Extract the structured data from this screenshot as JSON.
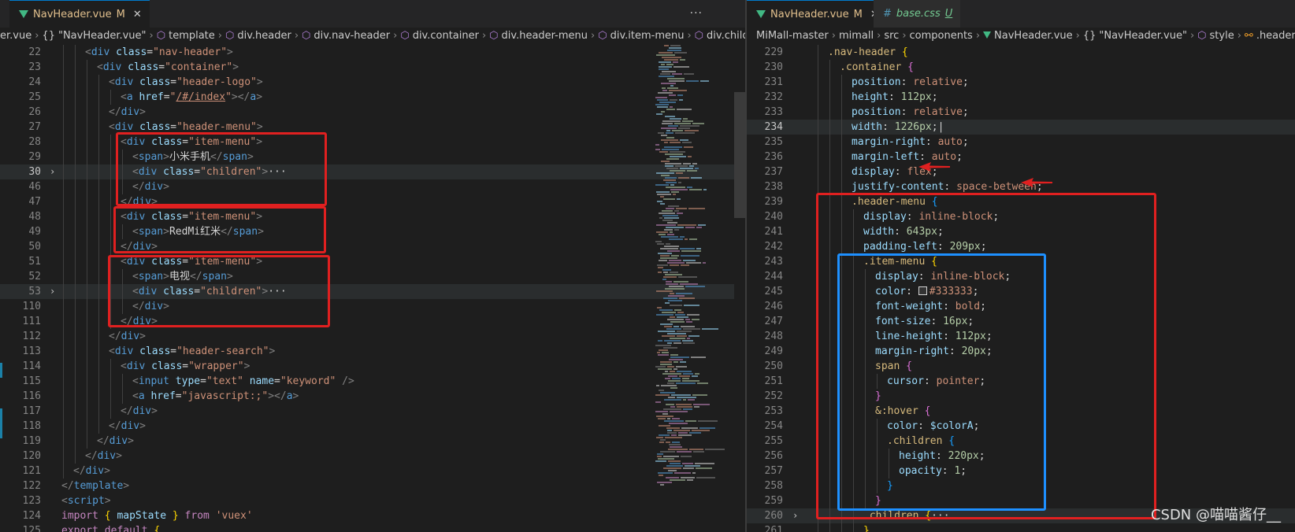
{
  "left": {
    "tabs": [
      {
        "name": "NavHeader.vue",
        "status": "M"
      }
    ],
    "more_label": "···",
    "breadcrumb": [
      "er.vue",
      "\"NavHeader.vue\"",
      "template",
      "div.header",
      "div.nav-header",
      "div.container",
      "div.header-menu",
      "div.item-menu",
      "div.children"
    ],
    "line_numbers": [
      "22",
      "23",
      "24",
      "25",
      "26",
      "27",
      "28",
      "29",
      "30",
      "46",
      "47",
      "48",
      "49",
      "50",
      "51",
      "52",
      "53",
      "110",
      "111",
      "112",
      "113",
      "114",
      "115",
      "116",
      "117",
      "118",
      "119",
      "120",
      "121",
      "122",
      "123",
      "124",
      "125"
    ]
  },
  "right": {
    "tabs": [
      {
        "name": "NavHeader.vue",
        "status": "M",
        "close": "✕"
      },
      {
        "name": "base.css",
        "status": "U"
      }
    ],
    "breadcrumb": [
      "MiMall-master",
      "mimall",
      "src",
      "components",
      "NavHeader.vue",
      "\"NavHeader.vue\"",
      "style",
      ".header"
    ],
    "line_numbers": [
      "229",
      "230",
      "231",
      "232",
      "233",
      "234",
      "235",
      "236",
      "237",
      "238",
      "239",
      "240",
      "241",
      "242",
      "243",
      "244",
      "245",
      "246",
      "247",
      "248",
      "249",
      "250",
      "251",
      "252",
      "253",
      "254",
      "255",
      "256",
      "257",
      "258",
      "259",
      "260",
      "261"
    ]
  },
  "colors": {
    "annotation_red": "#e02020",
    "annotation_blue": "#1e90ff",
    "swatch_333": "#333333"
  },
  "watermark": "CSDN @喵喵酱仔__"
}
